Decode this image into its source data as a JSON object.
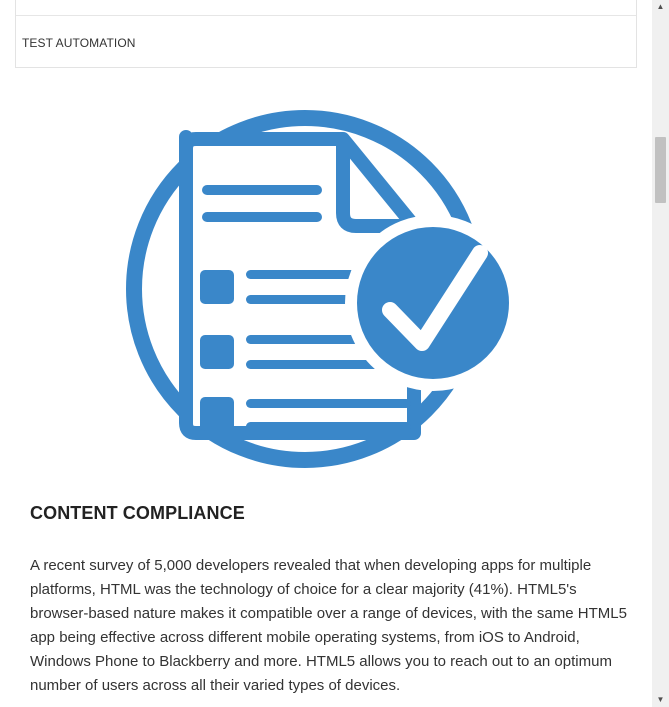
{
  "menu": {
    "items": [
      {
        "label": "TEST AUTOMATION"
      }
    ]
  },
  "section": {
    "title": "CONTENT COMPLIANCE",
    "body": "A recent survey of 5,000 developers revealed that when developing apps for multiple platforms, HTML was the technology of choice for a clear majority (41%). HTML5's browser-based nature makes it compatible over a range of devices, with the same HTML5 app being effective across different mobile operating systems, from iOS to Android, Windows Phone to Blackberry and more. HTML5 allows you to reach out to an optimum number of users across all their varied types of devices."
  },
  "illustration": {
    "icon": "document-checklist-check-icon",
    "color": "#3a87c9"
  },
  "scrollbar": {
    "up_arrow": "▲",
    "down_arrow": "▼",
    "position_fraction": 0.19
  },
  "colors": {
    "accent": "#3a87c9",
    "text": "#333333",
    "heading": "#222222",
    "border": "#e3e3e3"
  }
}
